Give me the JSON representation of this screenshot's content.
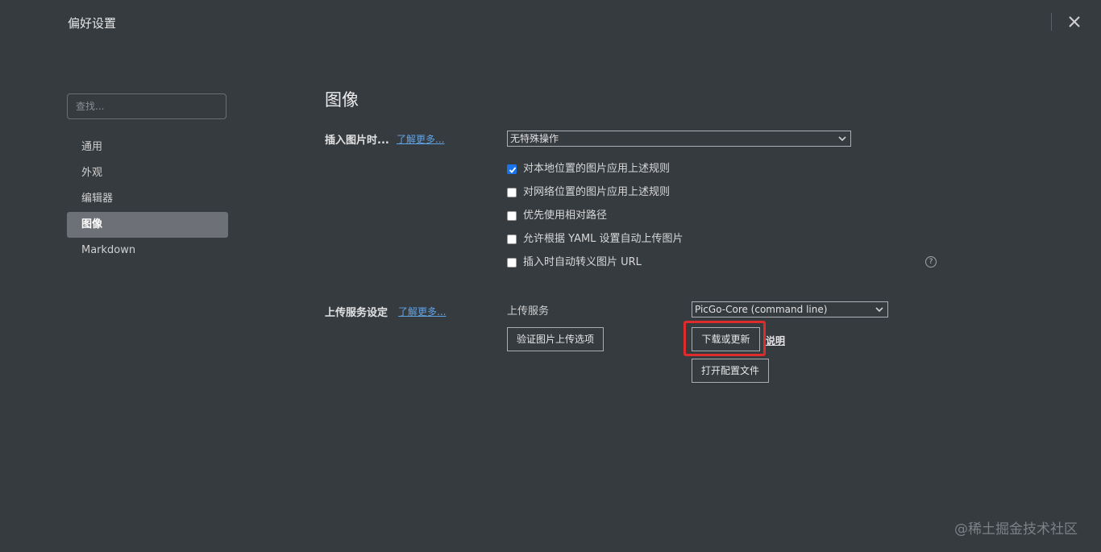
{
  "window": {
    "title": "偏好设置",
    "close_icon": "close-icon"
  },
  "sidebar": {
    "search_placeholder": "查找...",
    "items": [
      {
        "label": "通用",
        "active": false
      },
      {
        "label": "外观",
        "active": false
      },
      {
        "label": "编辑器",
        "active": false
      },
      {
        "label": "图像",
        "active": true
      },
      {
        "label": "Markdown",
        "active": false
      }
    ]
  },
  "main": {
    "title": "图像",
    "insert": {
      "label": "插入图片时...",
      "learn_more": "了解更多...",
      "select_value": "无特殊操作",
      "checkboxes": [
        {
          "label": "对本地位置的图片应用上述规则",
          "checked": true
        },
        {
          "label": "对网络位置的图片应用上述规则",
          "checked": false
        },
        {
          "label": "优先使用相对路径",
          "checked": false
        },
        {
          "label": "允许根据 YAML 设置自动上传图片",
          "checked": false
        },
        {
          "label": "插入时自动转义图片 URL",
          "checked": false
        }
      ],
      "help_glyph": "?"
    },
    "upload": {
      "label": "上传服务设定",
      "learn_more": "了解更多...",
      "service_label": "上传服务",
      "service_value": "PicGo-Core (command line)",
      "verify_button": "验证图片上传选项",
      "download_button": "下载或更新",
      "explain_link": "说明",
      "open_config_button": "打开配置文件"
    }
  },
  "watermark": "@稀土掘金技术社区",
  "colors": {
    "background": "#363b40",
    "active_item": "#6d7076",
    "link": "#5fa4e6",
    "highlight": "#e02b2b",
    "checkbox_on": "#1a73e8"
  }
}
